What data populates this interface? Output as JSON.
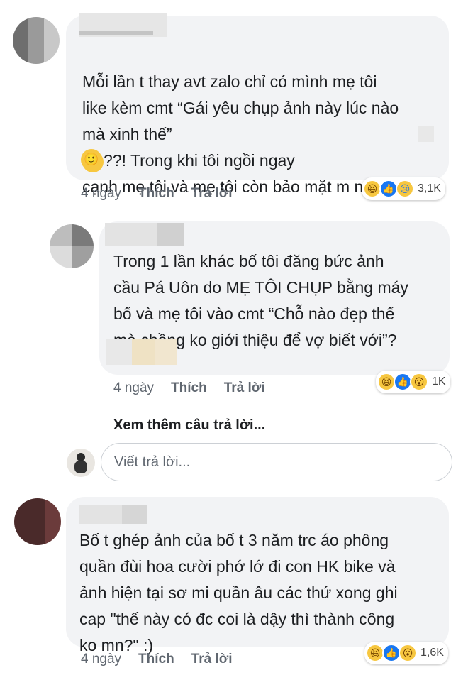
{
  "comments": [
    {
      "text": "Mỗi lần t thay avt zalo chỉ có mình mẹ tôi\nlike kèm cmt “Gái yêu chụp ảnh này lúc nào\nmà xinh thế”",
      "text_after_emoji": "??! Trong khi tôi ngồi ngay\ncạnh mẹ tôi và mẹ tôi còn bảo mặt m như",
      "time": "4 ngày",
      "like": "Thích",
      "reply": "Trả lời",
      "reaction_count": "3,1K"
    },
    {
      "text": "Trong 1 lần khác bố tôi đăng bức ảnh\ncầu Pá Uôn do MẸ TÔI CHỤP bằng máy\nbố và mẹ tôi vào cmt “Chỗ nào đẹp thế\nmà chồng ko giới thiệu để vợ biết với”?",
      "time": "4 ngày",
      "like": "Thích",
      "reply": "Trả lời",
      "reaction_count": "1K"
    },
    {
      "text": "Bố t ghép ảnh của bố t 3 năm trc áo phông\nquần đùi hoa cười phớ lớ đi con HK bike và\nảnh hiện tại sơ mi quần âu các thứ xong ghi\ncap \"thế này có đc coi là dậy thì thành công\nko mn?\" :)",
      "time": "4 ngày",
      "like": "Thích",
      "reply": "Trả lời",
      "reaction_count": "1,6K"
    }
  ],
  "more_replies": "Xem thêm câu trả lời...",
  "reply_input": {
    "placeholder": "Viết trả lời..."
  },
  "reaction_icons": [
    "haha-icon",
    "like-icon",
    "sad-icon",
    "wow-icon"
  ],
  "colors": {
    "bubble": "#f2f3f5",
    "meta": "#606770",
    "like_blue": "#1877f2",
    "emoji_yellow": "#f7c740"
  }
}
